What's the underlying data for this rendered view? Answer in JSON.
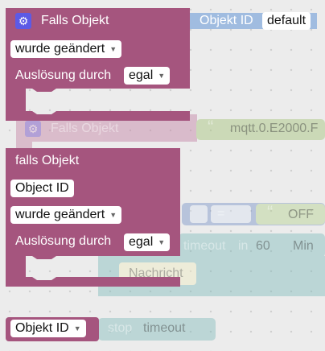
{
  "colors": {
    "background": "#ececec",
    "grid_dot": "#d6d6d6",
    "event_block": "#a5557e",
    "event_block_dark": "#7f3d5f",
    "id_block": "#a0bce0",
    "text_block": "#9fc06f",
    "logic_block": "#5b7bb8",
    "timeout_block": "#5aa0a0",
    "gear_tile": "#5c5ae6"
  },
  "blocks": {
    "falls_objekt_1": {
      "title": "Falls Objekt",
      "change_dropdown": "wurde geändert",
      "trigger_label": "Auslösung durch",
      "trigger_dropdown": "egal"
    },
    "objekt_id_top": {
      "label": "Objekt ID",
      "value": "default"
    },
    "falls_objekt_bg": {
      "title": "Falls Objekt",
      "quote": "“",
      "mqtt_text": "mqtt.0.E2000.F"
    },
    "falls_objekt_2": {
      "title": "falls Objekt",
      "object_id_field": "Object ID",
      "change_dropdown": "wurde geändert",
      "trigger_label": "Auslösung durch",
      "trigger_dropdown": "egal"
    },
    "compare_bg": {
      "operator": "=",
      "quote": "“",
      "value": "OFF"
    },
    "timeout_bg": {
      "timeout_label": "timeout",
      "in_label": "in",
      "delay_value": "60",
      "unit_dropdown": "Min",
      "message_label": "Nachricht"
    },
    "objekt_id_bottom": {
      "label": "Objekt ID"
    },
    "stop_bg": {
      "label": "stop",
      "dropdown": "timeout"
    }
  }
}
